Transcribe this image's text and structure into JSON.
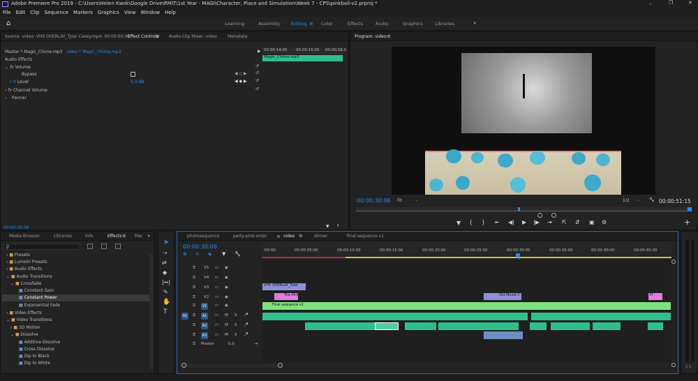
{
  "app": {
    "title": "Adobe Premiere Pro 2019 - C:\\Users\\Helen Kwok\\Google Drive\\RMIT\\1st Year - MAGI\\Character, Place and Simulation\\Week 7 - CPS\\pinkball-v2.prproj *"
  },
  "menu": [
    "File",
    "Edit",
    "Clip",
    "Sequence",
    "Markers",
    "Graphics",
    "View",
    "Window",
    "Help"
  ],
  "workspaces": [
    "Learning",
    "Assembly",
    "Editing",
    "Color",
    "Effects",
    "Audio",
    "Graphics",
    "Libraries"
  ],
  "source_tabs": {
    "source": "Source: video: VHS OVERLAY_Tyler Casey.mp4: 00:00:00:00",
    "effect_controls": "Effect Controls",
    "mixer": "Audio Clip Mixer: video",
    "metadata": "Metadata"
  },
  "effect_controls": {
    "master": "Master * Magic_Chime.mp3",
    "clip": "video * Magic_Chime.mp3",
    "ruler": [
      "00:00:14:00",
      "00:00:15:00",
      "00:00:16:0"
    ],
    "clipbar": "Magic_Chime.mp3",
    "section": "Audio Effects",
    "volume": "Volume",
    "bypass": "Bypass",
    "level": "Level",
    "level_value": "6.0 dB",
    "channel_volume": "Channel Volume",
    "panner": "Panner",
    "timecode": "00:00:30:06"
  },
  "program": {
    "title": "Program: video",
    "timecode": "00:00:30:06",
    "fit": "Fit",
    "ratio": "1/2",
    "duration": "00:00:51:15"
  },
  "project_tabs": {
    "media_browser": "Media Browser",
    "libraries": "Libraries",
    "info": "Info",
    "effects": "Effects",
    "markers": "Mar"
  },
  "effects_tree": [
    {
      "label": "Presets",
      "level": 0
    },
    {
      "label": "Lumetri Presets",
      "level": 0
    },
    {
      "label": "Audio Effects",
      "level": 0
    },
    {
      "label": "Audio Transitions",
      "level": 0
    },
    {
      "label": "Crossfade",
      "level": 1
    },
    {
      "label": "Constant Gain",
      "level": 2
    },
    {
      "label": "Constant Power",
      "level": 2
    },
    {
      "label": "Exponential Fade",
      "level": 2
    },
    {
      "label": "Video Effects",
      "level": 0
    },
    {
      "label": "Video Transitions",
      "level": 0
    },
    {
      "label": "3D Motion",
      "level": 1
    },
    {
      "label": "Dissolve",
      "level": 1
    },
    {
      "label": "Additive Dissolve",
      "level": 2
    },
    {
      "label": "Cross Dissolve",
      "level": 2
    },
    {
      "label": "Dip to Black",
      "level": 2
    },
    {
      "label": "Dip to White",
      "level": 2
    }
  ],
  "timeline": {
    "tabs": [
      "photosequence",
      "party-pink-enter",
      "video",
      "dinner",
      "final sequence v1"
    ],
    "timecode": "00:00:30:06",
    "ticks": [
      ":00:00",
      "00:00:05:00",
      "00:00:10:00",
      "00:00:15:00",
      "00:00:20:00",
      "00:00:25:00",
      "00:00:30:00",
      "00:00:35:00",
      "00:00:40:00",
      "00:00:45:00"
    ],
    "tracks": [
      "V5",
      "V4",
      "V3",
      "V2",
      "V1",
      "A1",
      "A2",
      "A3"
    ],
    "master_label": "Master",
    "master_value": "0.0",
    "clips": {
      "vhs": "VHS OVERLAY_Tyler",
      "pink": "The Pink",
      "oldmovie": "Old Movie C",
      "final": "Final sequence v1",
      "pi": "Pi"
    }
  },
  "colors": {
    "accent": "#2d8ceb",
    "audio_clip": "#2fbf8c",
    "video_clip": "#7fe07f",
    "purple": "#8f8fd8",
    "pink": "#e07be0"
  }
}
